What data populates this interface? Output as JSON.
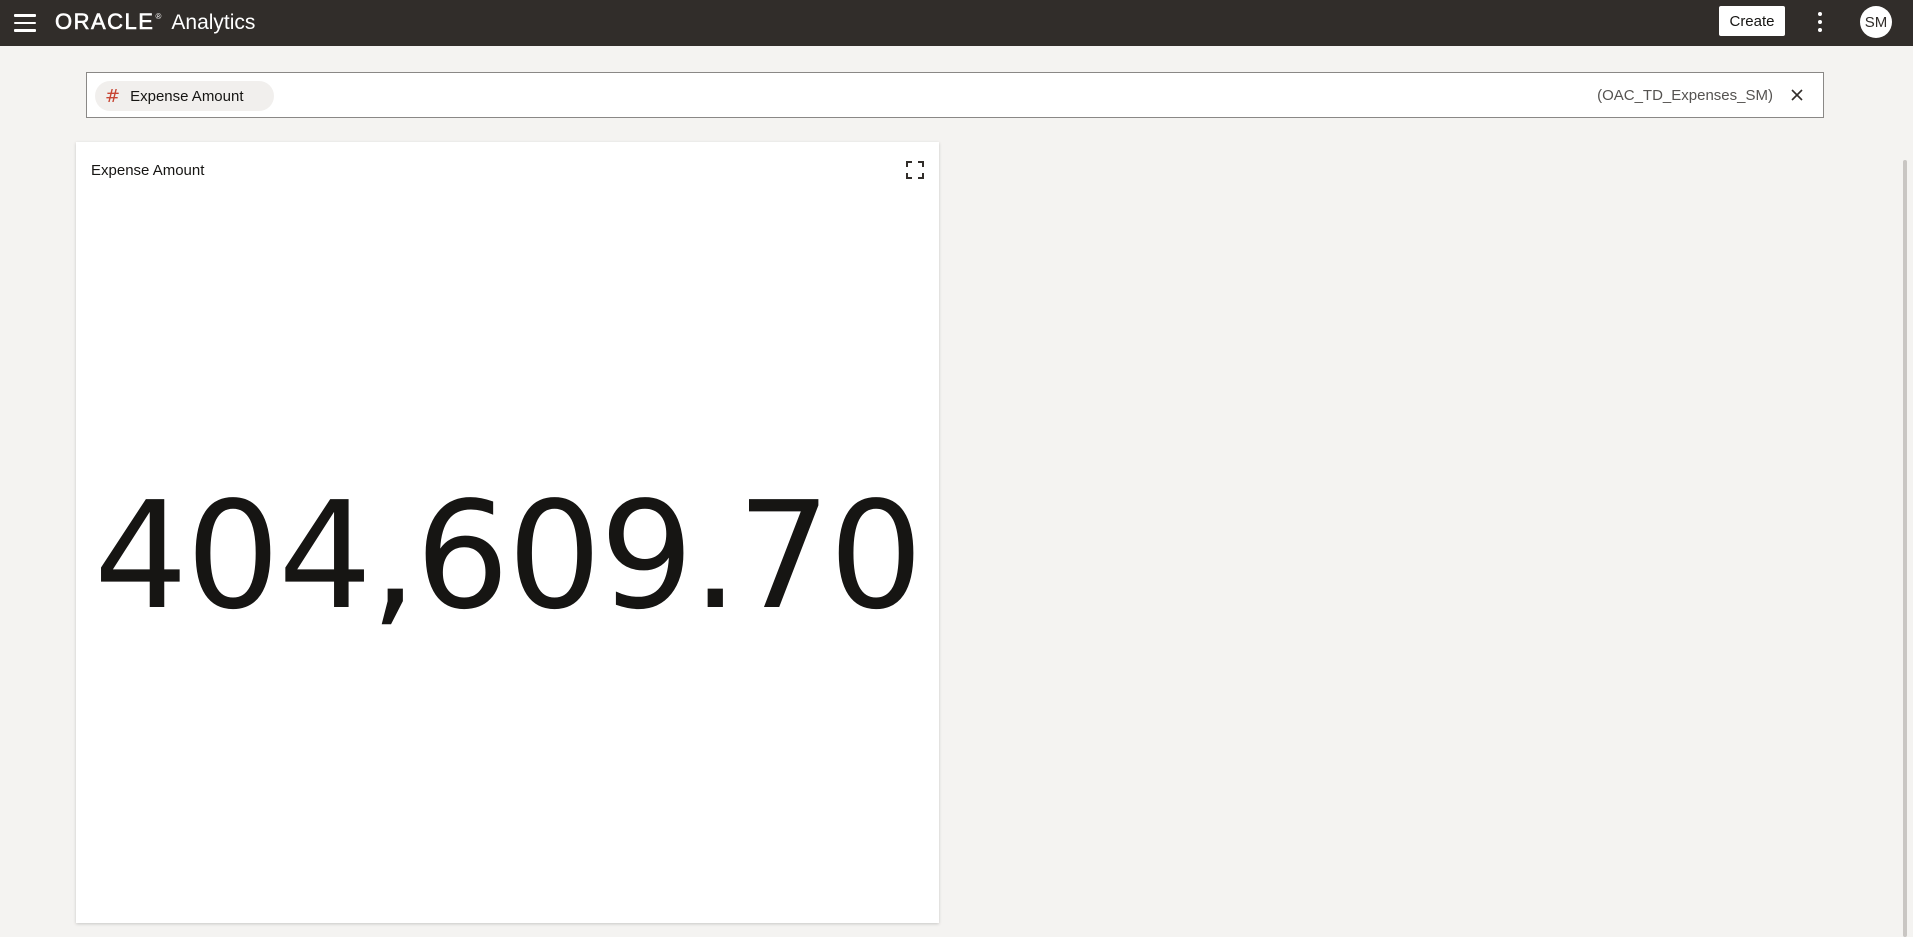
{
  "header": {
    "brand_oracle": "ORACLE",
    "brand_reg": "®",
    "brand_product": "Analytics",
    "create_label": "Create",
    "avatar_initials": "SM"
  },
  "search": {
    "chip_icon": "#",
    "chip_label": "Expense Amount",
    "datasource": "(OAC_TD_Expenses_SM)"
  },
  "tile": {
    "title": "Expense Amount",
    "value": "404,609.70"
  },
  "colors": {
    "topbar": "#312d2a",
    "chip_icon": "#c74634",
    "background": "#f4f3f1"
  }
}
